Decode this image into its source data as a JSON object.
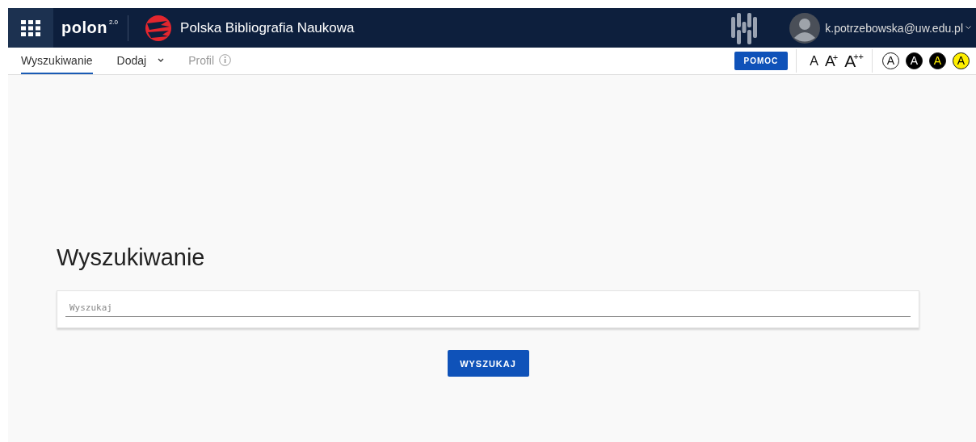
{
  "header": {
    "logo": {
      "name": "polon",
      "version": "2.0"
    },
    "app_title": "Polska Bibliografia Naukowa",
    "user": {
      "email": "k.potrzebowska@uw.edu.pl"
    }
  },
  "tabs": [
    {
      "label": "Wyszukiwanie",
      "selected": true,
      "kind": "plain",
      "disabled": false
    },
    {
      "label": "Dodaj",
      "selected": false,
      "kind": "dropdown",
      "disabled": false
    },
    {
      "label": "Profil",
      "selected": false,
      "kind": "info",
      "disabled": true
    }
  ],
  "help_button": "POMOC",
  "font_sizes": [
    {
      "label": "A"
    },
    {
      "label": "A",
      "suffix": "+"
    },
    {
      "label": "A",
      "suffix": "++"
    }
  ],
  "contrast_modes": [
    {
      "label": "A",
      "kind": "white"
    },
    {
      "label": "A",
      "kind": "black"
    },
    {
      "label": "A",
      "kind": "black-yellow"
    },
    {
      "label": "A",
      "kind": "yellow"
    }
  ],
  "page_title": "Wyszukiwanie",
  "search": {
    "placeholder": "Wyszukaj"
  },
  "search_button": "WYSZUKAJ"
}
